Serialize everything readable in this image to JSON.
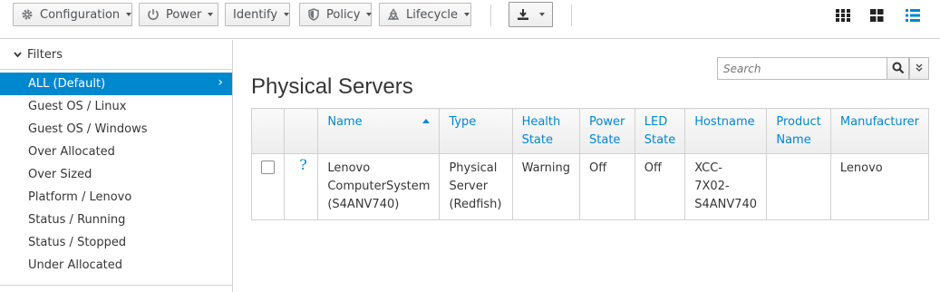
{
  "toolbar": {
    "configuration_label": "Configuration",
    "power_label": "Power",
    "identify_label": "Identify",
    "policy_label": "Policy",
    "lifecycle_label": "Lifecycle"
  },
  "sidebar": {
    "heading": "Filters",
    "items": [
      {
        "label": "ALL (Default)",
        "active": true
      },
      {
        "label": "Guest OS / Linux"
      },
      {
        "label": "Guest OS / Windows"
      },
      {
        "label": "Over Allocated"
      },
      {
        "label": "Over Sized"
      },
      {
        "label": "Platform / Lenovo"
      },
      {
        "label": "Status / Running"
      },
      {
        "label": "Status / Stopped"
      },
      {
        "label": "Under Allocated"
      }
    ]
  },
  "main": {
    "title": "Physical Servers",
    "search": {
      "placeholder": "Search",
      "value": ""
    },
    "table": {
      "columns": [
        "Name",
        "Type",
        "Health State",
        "Power State",
        "LED State",
        "Hostname",
        "Product Name",
        "Manufacturer"
      ],
      "sorted_column": "Name",
      "rows": [
        {
          "icon": "?",
          "name": "Lenovo ComputerSystem (S4ANV740)",
          "type": "Physical Server (Redfish)",
          "health_state": "Warning",
          "power_state": "Off",
          "led_state": "Off",
          "hostname": "XCC-7X02-S4ANV740",
          "product_name": "",
          "manufacturer": "Lenovo"
        }
      ]
    }
  },
  "colors": {
    "accent": "#0088ce",
    "border": "#d1d1d1"
  }
}
